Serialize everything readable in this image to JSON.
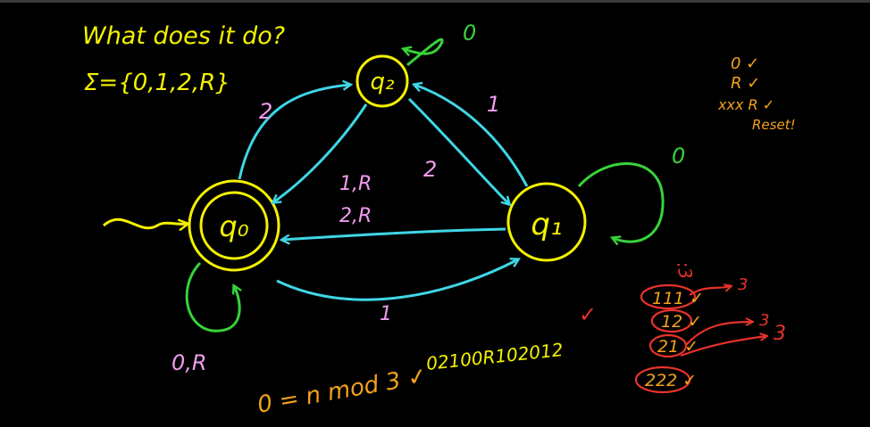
{
  "header": {
    "question": "What does it do?",
    "alphabet": "Σ={0,1,2,R}"
  },
  "states": {
    "q0": "q₀",
    "q1": "q₁",
    "q2": "q₂"
  },
  "edges": {
    "q0_to_q2": "2",
    "q2_to_q0": "1,R",
    "q2_loop": "0",
    "q1_to_q2": "1",
    "q2_to_q1": "2",
    "q1_loop": "0",
    "q1_to_q0": "2,R",
    "q0_to_q1": "1",
    "q0_loop": "0,R"
  },
  "notes": {
    "right_top": [
      "0 ✓",
      "R ✓",
      "xxx R ✓",
      "Reset!"
    ],
    "answer": "0 = n mod 3 ✓",
    "input_string": "02100R102012",
    "check_mark": "✓",
    "frown": ":3",
    "tests": [
      "111 ✓",
      "12 ✓",
      "21 ✓",
      "222 ✓"
    ],
    "arrow_labels": [
      "3",
      "3",
      "3"
    ]
  },
  "colors": {
    "yellow": "#f4f100",
    "cyan": "#3fd6e6",
    "green": "#37d33a",
    "pink": "#f19cf0",
    "orange": "#f3a21b",
    "red": "#e8322b"
  }
}
